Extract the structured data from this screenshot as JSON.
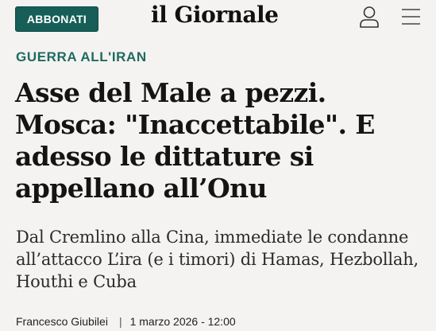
{
  "header": {
    "subscribe_label": "ABBONATI",
    "logo_text": "il Giornale",
    "icons": [
      "user-icon",
      "menu-icon"
    ]
  },
  "article": {
    "section": "GUERRA ALL'IRAN",
    "title": "Asse del Male a pezzi. Mosca: \"Inaccettabile\". E adesso le dittature si appellano all’Onu",
    "subtitle": "Dal Cremlino alla Cina, immediate le condanne all’attacco L’ira (e i timori) di Hamas, Hezbollah, Houthi e Cuba",
    "author": "Francesco Giubilei",
    "separator": "|",
    "date": "1 marzo 2026 - 12:00"
  },
  "colors": {
    "accent": "#165e57",
    "section": "#1f6a60",
    "background": "#f4f3f1"
  }
}
